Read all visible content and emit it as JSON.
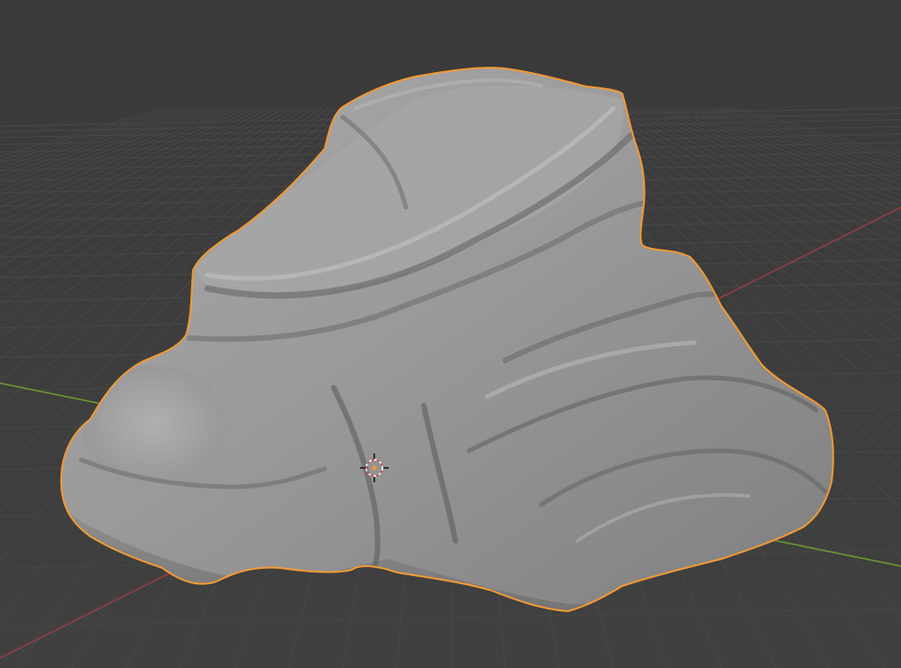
{
  "viewport": {
    "background_color": "#3d3d3d",
    "grid_color": "#474747",
    "x_axis_color": "#9a3a40",
    "y_axis_color": "#6a9a2e",
    "selection_outline_color": "#f29a33"
  },
  "objects": [
    {
      "kind": "sculpted-rock-mesh",
      "selected": true,
      "shading": "solid"
    }
  ],
  "origin_marker": {
    "icon": "crosshair-origin-icon"
  }
}
